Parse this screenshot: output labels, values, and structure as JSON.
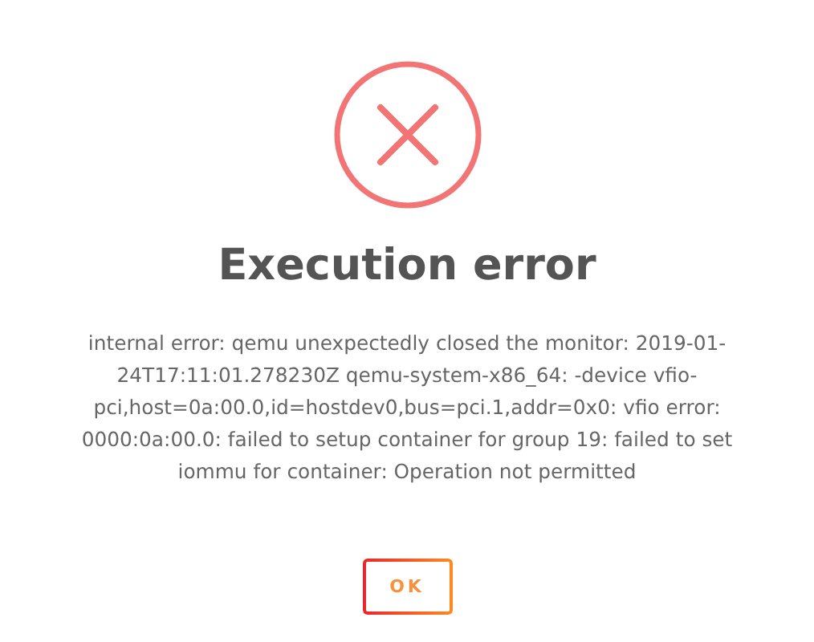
{
  "dialog": {
    "title": "Execution error",
    "message": "internal error: qemu unexpectedly closed the monitor: 2019-01-24T17:11:01.278230Z qemu-system-x86_64: -device vfio-pci,host=0a:00.0,id=hostdev0,bus=pci.1,addr=0x0: vfio error: 0000:0a:00.0: failed to setup container for group 19: failed to set iommu for container: Operation not permitted",
    "buttons": [
      "OK"
    ]
  }
}
